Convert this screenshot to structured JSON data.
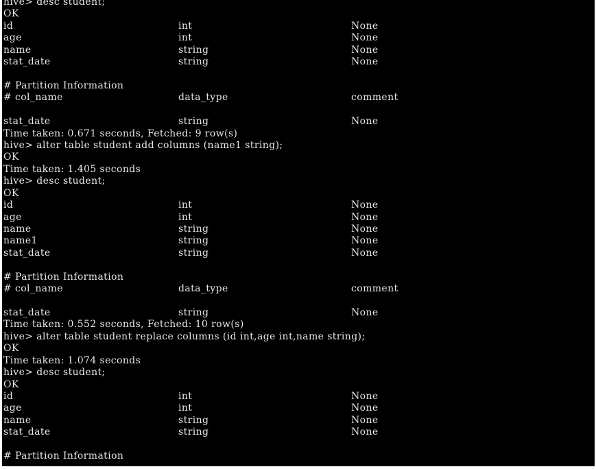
{
  "terminal": {
    "lines": [
      {
        "type": "text",
        "text": "hive> desc student;"
      },
      {
        "type": "text",
        "text": "OK"
      },
      {
        "type": "row",
        "cols": [
          "id",
          "int",
          "None"
        ]
      },
      {
        "type": "row",
        "cols": [
          "age",
          "int",
          "None"
        ]
      },
      {
        "type": "row",
        "cols": [
          "name",
          "string",
          "None"
        ]
      },
      {
        "type": "row",
        "cols": [
          "stat_date",
          "string",
          "None"
        ]
      },
      {
        "type": "blank"
      },
      {
        "type": "text",
        "text": "# Partition Information"
      },
      {
        "type": "row",
        "cols": [
          "# col_name",
          "data_type",
          "comment"
        ]
      },
      {
        "type": "blank"
      },
      {
        "type": "row",
        "cols": [
          "stat_date",
          "string",
          "None"
        ]
      },
      {
        "type": "text",
        "text": "Time taken: 0.671 seconds, Fetched: 9 row(s)"
      },
      {
        "type": "text",
        "text": "hive> alter table student add columns (name1 string);"
      },
      {
        "type": "text",
        "text": "OK"
      },
      {
        "type": "text",
        "text": "Time taken: 1.405 seconds"
      },
      {
        "type": "text",
        "text": "hive> desc student;"
      },
      {
        "type": "text",
        "text": "OK"
      },
      {
        "type": "row",
        "cols": [
          "id",
          "int",
          "None"
        ]
      },
      {
        "type": "row",
        "cols": [
          "age",
          "int",
          "None"
        ]
      },
      {
        "type": "row",
        "cols": [
          "name",
          "string",
          "None"
        ]
      },
      {
        "type": "row",
        "cols": [
          "name1",
          "string",
          "None"
        ]
      },
      {
        "type": "row",
        "cols": [
          "stat_date",
          "string",
          "None"
        ]
      },
      {
        "type": "blank"
      },
      {
        "type": "text",
        "text": "# Partition Information"
      },
      {
        "type": "row",
        "cols": [
          "# col_name",
          "data_type",
          "comment"
        ]
      },
      {
        "type": "blank"
      },
      {
        "type": "row",
        "cols": [
          "stat_date",
          "string",
          "None"
        ]
      },
      {
        "type": "text",
        "text": "Time taken: 0.552 seconds, Fetched: 10 row(s)"
      },
      {
        "type": "text",
        "text": "hive> alter table student replace columns (id int,age int,name string);"
      },
      {
        "type": "text",
        "text": "OK"
      },
      {
        "type": "text",
        "text": "Time taken: 1.074 seconds"
      },
      {
        "type": "text",
        "text": "hive> desc student;"
      },
      {
        "type": "text",
        "text": "OK"
      },
      {
        "type": "row",
        "cols": [
          "id",
          "int",
          "None"
        ]
      },
      {
        "type": "row",
        "cols": [
          "age",
          "int",
          "None"
        ]
      },
      {
        "type": "row",
        "cols": [
          "name",
          "string",
          "None"
        ]
      },
      {
        "type": "row",
        "cols": [
          "stat_date",
          "string",
          "None"
        ]
      },
      {
        "type": "blank"
      },
      {
        "type": "text",
        "text": "# Partition Information"
      }
    ]
  },
  "colors": {
    "background": "#000000",
    "text": "#e6e6e6"
  }
}
